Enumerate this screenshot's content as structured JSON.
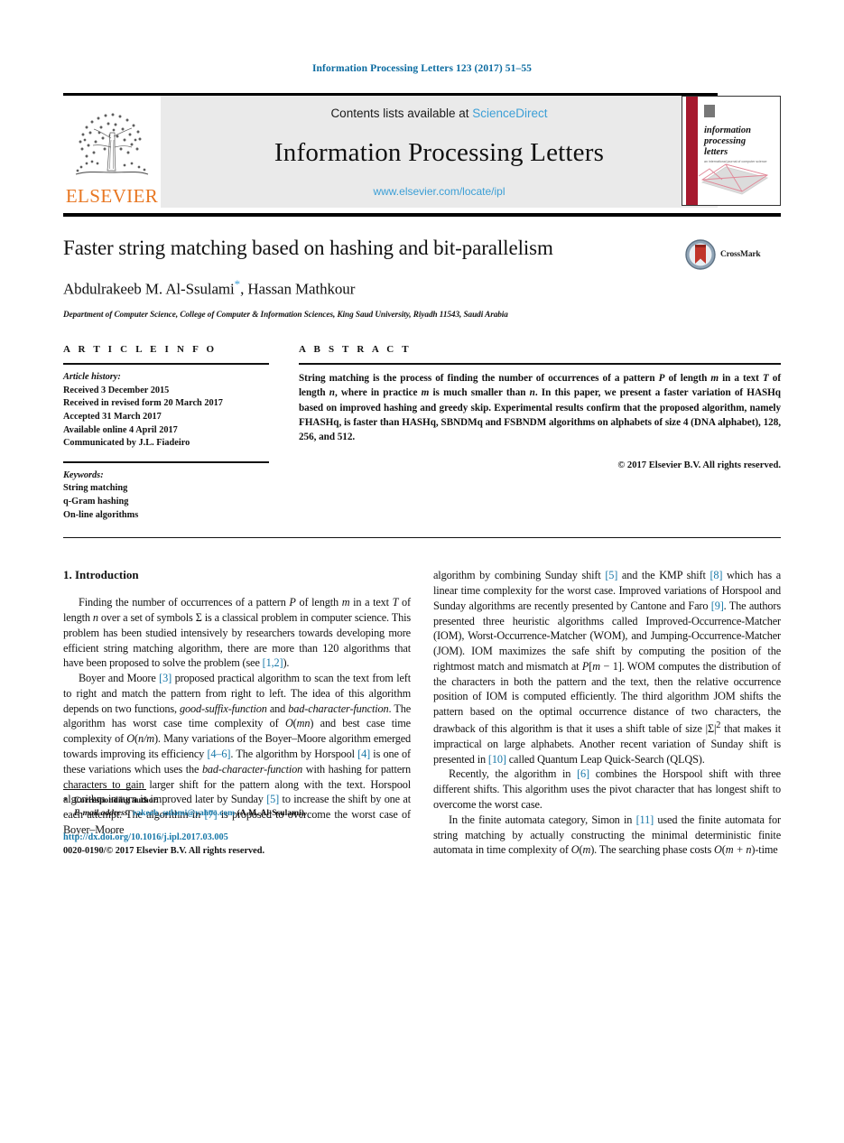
{
  "running_head": "Information Processing Letters 123 (2017) 51–55",
  "masthead": {
    "contents_prefix": "Contents lists available at ",
    "sciencedirect": "ScienceDirect",
    "journal_name": "Information Processing Letters",
    "journal_url": "www.elsevier.com/locate/ipl",
    "publisher": "ELSEVIER",
    "cover_title_lines": [
      "information",
      "processing",
      "letters"
    ]
  },
  "title": "Faster string matching based on hashing and bit-parallelism",
  "authors": "Abdulrakeeb M. Al-Ssulami",
  "author_star": "*",
  "authors_rest": ", Hassan Mathkour",
  "affiliation": "Department of Computer Science, College of Computer & Information Sciences, King Saud University, Riyadh 11543, Saudi Arabia",
  "crossmark_label": "CrossMark",
  "article_info": {
    "kicker": "A R T I C L E   I N F O",
    "history_label": "Article history:",
    "history": [
      "Received 3 December 2015",
      "Received in revised form 20 March 2017",
      "Accepted 31 March 2017",
      "Available online 4 April 2017",
      "Communicated by J.L. Fiadeiro"
    ],
    "keywords_label": "Keywords:",
    "keywords": [
      "String matching",
      "q-Gram hashing",
      "On-line algorithms"
    ]
  },
  "abstract": {
    "kicker": "A B S T R A C T",
    "text": "String matching is the process of finding the number of occurrences of a pattern P of length m in a text T of length n, where in practice m is much smaller than n. In this paper, we present a faster variation of HASHq based on improved hashing and greedy skip. Experimental results confirm that the proposed algorithm, namely FHASHq, is faster than HASHq, SBNDMq and FSBNDM algorithms on alphabets of size 4 (DNA alphabet), 128, 256, and 512.",
    "copyright": "© 2017 Elsevier B.V. All rights reserved."
  },
  "body": {
    "section_heading": "1. Introduction",
    "left_paragraphs": [
      "Finding the number of occurrences of a pattern P of length m in a text T of length n over a set of symbols Σ is a classical problem in computer science. This problem has been studied intensively by researchers towards developing more efficient string matching algorithm, there are more than 120 algorithms that have been proposed to solve the problem (see [1,2]).",
      "Boyer and Moore [3] proposed practical algorithm to scan the text from left to right and match the pattern from right to left. The idea of this algorithm depends on two functions, good-suffix-function and bad-character-function. The algorithm has worst case time complexity of O(mn) and best case time complexity of O(n/m). Many variations of the Boyer–Moore algorithm emerged towards improving its efficiency [4–6]. The algorithm by Horspool [4] is one of these variations which uses the bad-character-function with hashing for pattern characters to gain larger shift for the pattern along with the text. Horspool algorithm in turn is improved later by Sunday [5] to increase the shift by one at each attempt. The algorithm in [7] is proposed to overcome the worst case of Boyer–Moore"
    ],
    "right_paragraphs": [
      "algorithm by combining Sunday shift [5] and the KMP shift [8] which has a linear time complexity for the worst case. Improved variations of Horspool and Sunday algorithms are recently presented by Cantone and Faro [9]. The authors presented three heuristic algorithms called Improved-Occurrence-Matcher (IOM), Worst-Occurrence-Matcher (WOM), and Jumping-Occurrence-Matcher (JOM). IOM maximizes the safe shift by computing the position of the rightmost match and mismatch at P[m − 1]. WOM computes the distribution of the characters in both the pattern and the text, then the relative occurrence position of IOM is computed efficiently. The third algorithm JOM shifts the pattern based on the optimal occurrence distance of two characters, the drawback of this algorithm is that it uses a shift table of size |Σ|2 that makes it impractical on large alphabets. Another recent variation of Sunday shift is presented in [10] called Quantum Leap Quick-Search (QLQS).",
      "Recently, the algorithm in [6] combines the Horspool shift with three different shifts. This algorithm uses the pivot character that has longest shift to overcome the worst case.",
      "In the finite automata category, Simon in [11] used the finite automata for string matching by actually constructing the minimal deterministic finite automata in time complexity of O(m). The searching phase costs O(m + n)-time"
    ]
  },
  "footnote": {
    "corresponding_author": "Corresponding author.",
    "email_label": "E-mail address:",
    "email": "rakeeb_sulami@yahoo.com",
    "email_suffix": "(A.M. Al-Ssulami).",
    "doi": "http://dx.doi.org/10.1016/j.ipl.2017.03.005",
    "issn_line": "0020-0190/© 2017 Elsevier B.V. All rights reserved."
  },
  "colors": {
    "link": "#1878a8",
    "sciencedirect": "#3c9fd6",
    "elsevier_orange": "#E87722",
    "cover_red": "#A6192E"
  }
}
